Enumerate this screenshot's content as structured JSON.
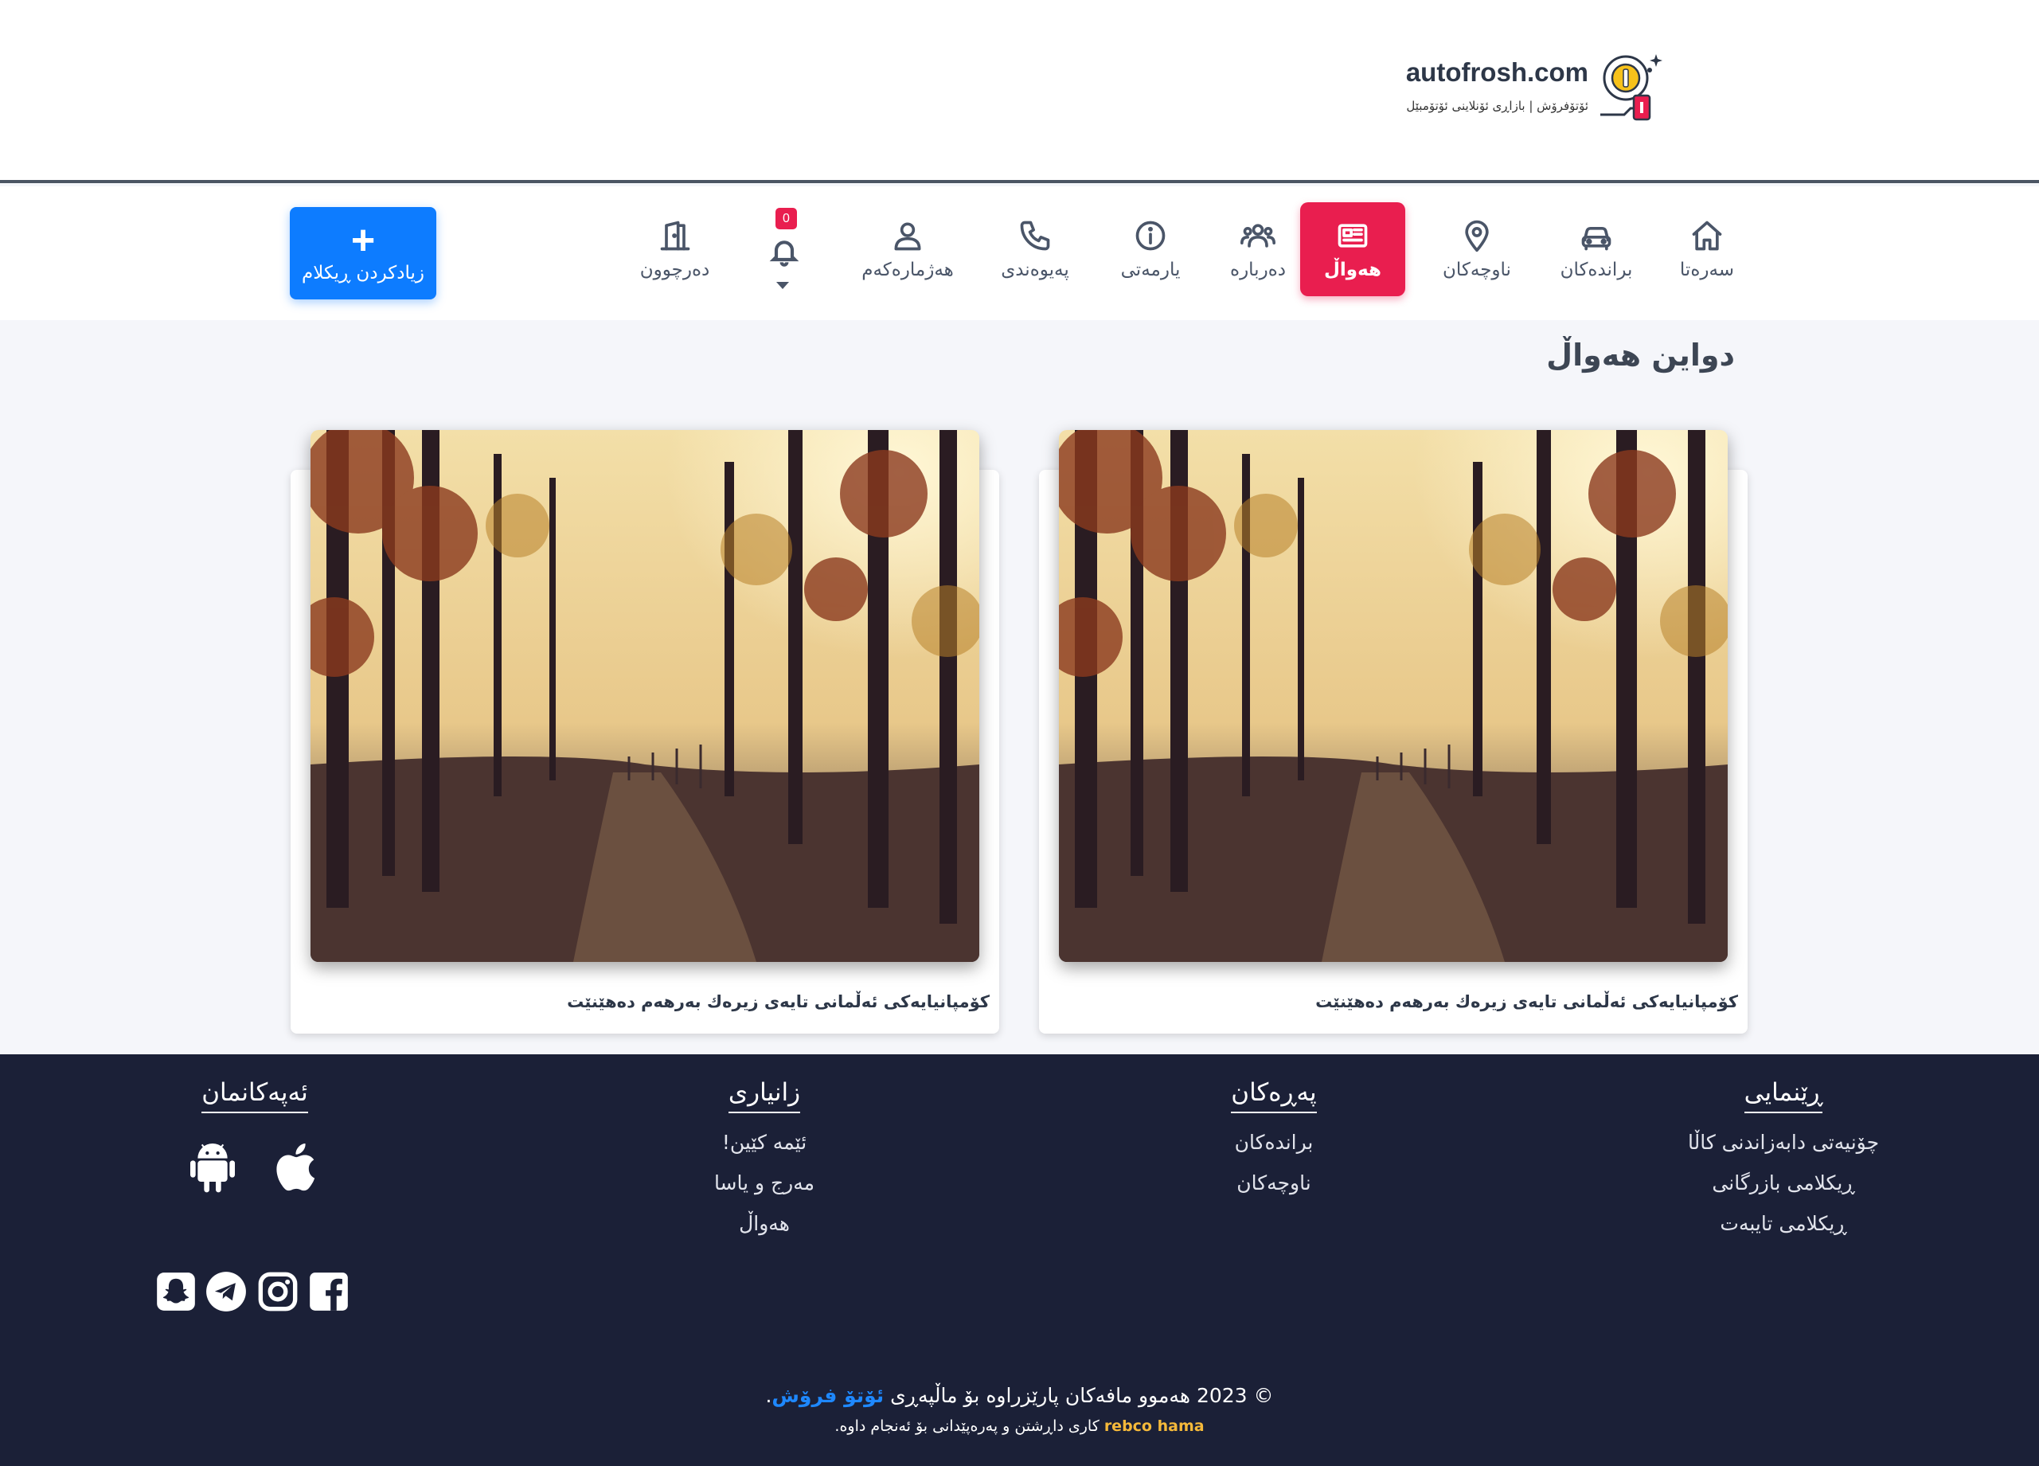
{
  "header": {
    "logo_text": "autofrosh.com",
    "logo_subtitle": "ئۆتۆفرۆش | بازاڕی ئۆنلاینی ئۆتۆمبێل"
  },
  "nav": {
    "items": [
      {
        "label": "سەرەتا",
        "icon": "home-icon"
      },
      {
        "label": "براندەکان",
        "icon": "car-icon"
      },
      {
        "label": "ناوچەکان",
        "icon": "map-pin-icon"
      },
      {
        "label": "هەواڵ",
        "icon": "newspaper-icon"
      },
      {
        "label": "دەربارە",
        "icon": "users-icon"
      },
      {
        "label": "یارمەتی",
        "icon": "info-icon"
      },
      {
        "label": "پەیوەندی",
        "icon": "phone-icon"
      },
      {
        "label": "هەژمارەکەم",
        "icon": "user-icon"
      },
      {
        "label": "دەرچوون",
        "icon": "exit-door-icon"
      }
    ],
    "active": "هەواڵ",
    "notifications_count": "0",
    "add_button": {
      "icon": "+",
      "label": "زیادکردن ڕیکلام"
    },
    "accent_color": "#e91e4f",
    "button_color": "#0d7cff"
  },
  "news": {
    "title": "دواین هەواڵ",
    "cards": [
      {
        "title": "کۆمپانیایەکی ئەڵمانی تایەی زیرەك بەرهەم دەهێنێت"
      },
      {
        "title": "کۆمپانیایەکی ئەڵمانی تایەی زیرەك بەرهەم دەهێنێت"
      }
    ]
  },
  "footer": {
    "guide": {
      "heading": "ڕێنمایی",
      "links": [
        "چۆنیەتی دابەزاندنی کاڵا",
        "ڕیکلامی بازرگانی",
        "ڕیکلامی تایبەت"
      ]
    },
    "pages": {
      "heading": "پەڕەکان",
      "links": [
        "براندەکان",
        "ناوچەکان"
      ]
    },
    "info": {
      "heading": "زانیاری",
      "links": [
        "ئێمە کێین!",
        "مەرج و یاسا",
        "هەواڵ"
      ]
    },
    "apps": {
      "heading": "ئەپەکانمان",
      "icons": [
        "apple-icon",
        "android-icon"
      ]
    },
    "social_icons": [
      "facebook-icon",
      "instagram-icon",
      "telegram-icon",
      "snapchat-icon"
    ],
    "copyright_prefix": "© 2023 هەموو مافەکان پارێزراوە بۆ ماڵپەڕی",
    "copyright_brand": "ئۆتۆ فرۆش",
    "copyright_suffix": ".",
    "credit_dev": "rebco hama",
    "credit_text": "کاری داڕشتن و پەرەپێدانی بۆ ئەنجام داوە.",
    "background_color": "#1b2037",
    "brand_color": "#1e88ff",
    "dev_color": "#f5b93a"
  }
}
